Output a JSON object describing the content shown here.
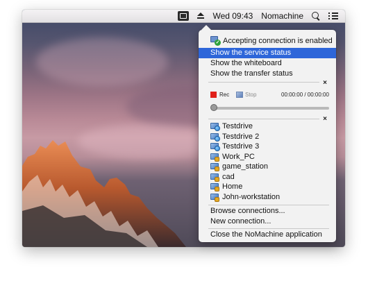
{
  "menubar": {
    "clock": "Wed 09:43",
    "user": "Nomachine"
  },
  "popup": {
    "status": "Accepting connection is enabled",
    "menu": [
      "Show the service status",
      "Show the whiteboard",
      "Show the transfer status"
    ],
    "recorder": {
      "rec_label": "Rec",
      "stop_label": "Stop",
      "time": "00:00:00 / 00:00:00",
      "progress": 0
    },
    "connections": [
      {
        "name": "Testdrive",
        "type": "network"
      },
      {
        "name": "Testdrive 2",
        "type": "network"
      },
      {
        "name": "Testdrive 3",
        "type": "network"
      },
      {
        "name": "Work_PC",
        "type": "local"
      },
      {
        "name": "game_station",
        "type": "local"
      },
      {
        "name": "cad",
        "type": "local"
      },
      {
        "name": "Home",
        "type": "local"
      },
      {
        "name": "John-workstation",
        "type": "local"
      }
    ],
    "actions": [
      "Browse connections...",
      "New connection..."
    ],
    "close_app": "Close the NoMachine application"
  },
  "colors": {
    "selection": "#2e66d9",
    "rec": "#e0201a"
  }
}
